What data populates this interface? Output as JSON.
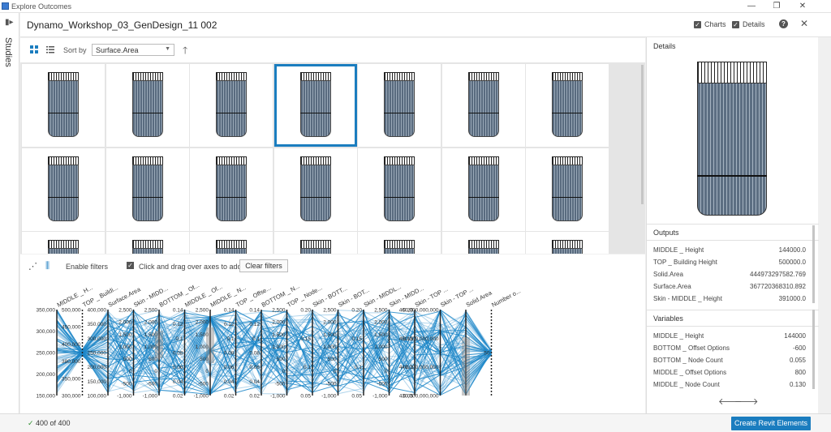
{
  "window": {
    "title": "Explore Outcomes",
    "minimize_glyph": "—",
    "restore_glyph": "❐",
    "close_glyph": "✕"
  },
  "rail": {
    "studies_label": "Studies",
    "collapse_icon": "panel-collapse-icon"
  },
  "header": {
    "title": "Dynamo_Workshop_03_GenDesign_11 002",
    "charts_label": "Charts",
    "details_label": "Details",
    "help_glyph": "?",
    "close_glyph": "✕"
  },
  "toolbar": {
    "sort_label": "Sort by",
    "sort_value": "Surface.Area",
    "grid_view_icon": "grid-view-icon",
    "list_view_icon": "list-view-icon",
    "sort_direction_icon": "arrow-up-icon"
  },
  "grid": {
    "selected_index": 3
  },
  "filterbar": {
    "enable_filters_label": "Enable filters",
    "hint": "Click and drag over axes to add filters",
    "clear_label": "Clear filters"
  },
  "parallel_axes": [
    {
      "name": "MIDDLE _ H...",
      "ticks": [
        "350,000",
        "300,000",
        "250,000",
        "200,000",
        "150,000"
      ]
    },
    {
      "name": "TOP _ Buildi...",
      "ticks": [
        "500,000",
        "450,000",
        "400,000",
        "380,000",
        "350,000",
        "300,000"
      ]
    },
    {
      "name": "Surface.Area",
      "ticks": [
        "400,000",
        "350,000",
        "300,000",
        "250,000",
        "200,000",
        "150,000",
        "100,000"
      ]
    },
    {
      "name": "Skin - MIDD...",
      "ticks": [
        "2,500",
        "2,000",
        "1,500",
        "1,000",
        "500",
        "0",
        "-500",
        "-1,000"
      ]
    },
    {
      "name": "BOTTOM _ Of...",
      "ticks": [
        "2,500",
        "2,000",
        "1,500",
        "1,000",
        "500",
        "0",
        "-500",
        "-1,000"
      ]
    },
    {
      "name": "MIDDLE _ Of...",
      "ticks": [
        "0.14",
        "0.12",
        "0.1",
        "0.08",
        "0.06",
        "0.04",
        "0.02"
      ]
    },
    {
      "name": "MIDDLE _ N...",
      "ticks": [
        "2,500",
        "2,000",
        "1,500",
        "1,000",
        "500",
        "0",
        "-500",
        "-1,000"
      ]
    },
    {
      "name": "TOP _ Offse...",
      "ticks": [
        "0.14",
        "0.12",
        "0.1",
        "0.08",
        "0.06",
        "0.04",
        "0.02"
      ]
    },
    {
      "name": "BOTTOM _ N...",
      "ticks": [
        "0.14",
        "0.12",
        "0.1",
        "0.08",
        "0.06",
        "0.04",
        "0.02"
      ]
    },
    {
      "name": "TOP _ Node...",
      "ticks": [
        "2,500",
        "2,000",
        "1,500",
        "1,000",
        "500",
        "0",
        "-500",
        "-1,000"
      ]
    },
    {
      "name": "Skin - BOTT...",
      "ticks": [
        "0.20",
        "0.15",
        "0.1",
        "0.05"
      ]
    },
    {
      "name": "Skin - BOT...",
      "ticks": [
        "2,500",
        "2,000",
        "1,500",
        "1,000",
        "500",
        "0",
        "-500",
        "-1,000"
      ]
    },
    {
      "name": "Skin - MIDDL...",
      "ticks": [
        "0.20",
        "0.15",
        "0.1",
        "0.05"
      ]
    },
    {
      "name": "Skin - MIDD...",
      "ticks": [
        "2,500",
        "2,000",
        "1,500",
        "1,000",
        "500",
        "0",
        "-500",
        "-1,000"
      ]
    },
    {
      "name": "Skin - TOP ...",
      "ticks": [
        "0.20",
        "0.15",
        "0.1",
        "0.05"
      ]
    },
    {
      "name": "Skin - TOP ...",
      "ticks": [
        "460,000,000,000",
        "450,000,000,000",
        "440,000,000,000",
        "430,000,000,000"
      ]
    },
    {
      "name": "Solid.Area",
      "ticks": []
    },
    {
      "name": "Number o...",
      "ticks": [
        "50"
      ]
    }
  ],
  "details": {
    "title": "Details",
    "outputs_title": "Outputs",
    "outputs": [
      {
        "k": "MIDDLE _ Height",
        "v": "144000.0"
      },
      {
        "k": "TOP _ Building Height",
        "v": "500000.0"
      },
      {
        "k": "Solid.Area",
        "v": "444973297582.769"
      },
      {
        "k": "Surface.Area",
        "v": "367720368310.892"
      },
      {
        "k": "Skin - MIDDLE _ Height",
        "v": "391000.0"
      }
    ],
    "variables_title": "Variables",
    "variables": [
      {
        "k": "MIDDLE _ Height",
        "v": "144000"
      },
      {
        "k": "BOTTOM _ Offset Options",
        "v": "-600"
      },
      {
        "k": "BOTTOM _ Node Count",
        "v": "0.055"
      },
      {
        "k": "MIDDLE _ Offset Options",
        "v": "800"
      },
      {
        "k": "MIDDLE _ Node Count",
        "v": "0.130"
      }
    ],
    "prev_glyph": "🡐",
    "next_glyph": "🡒"
  },
  "status": {
    "check_glyph": "✓",
    "count_text": "400 of 400",
    "create_label": "Create Revit Elements"
  },
  "colors": {
    "accent": "#1b7dbf",
    "line": "#1f88c9"
  }
}
